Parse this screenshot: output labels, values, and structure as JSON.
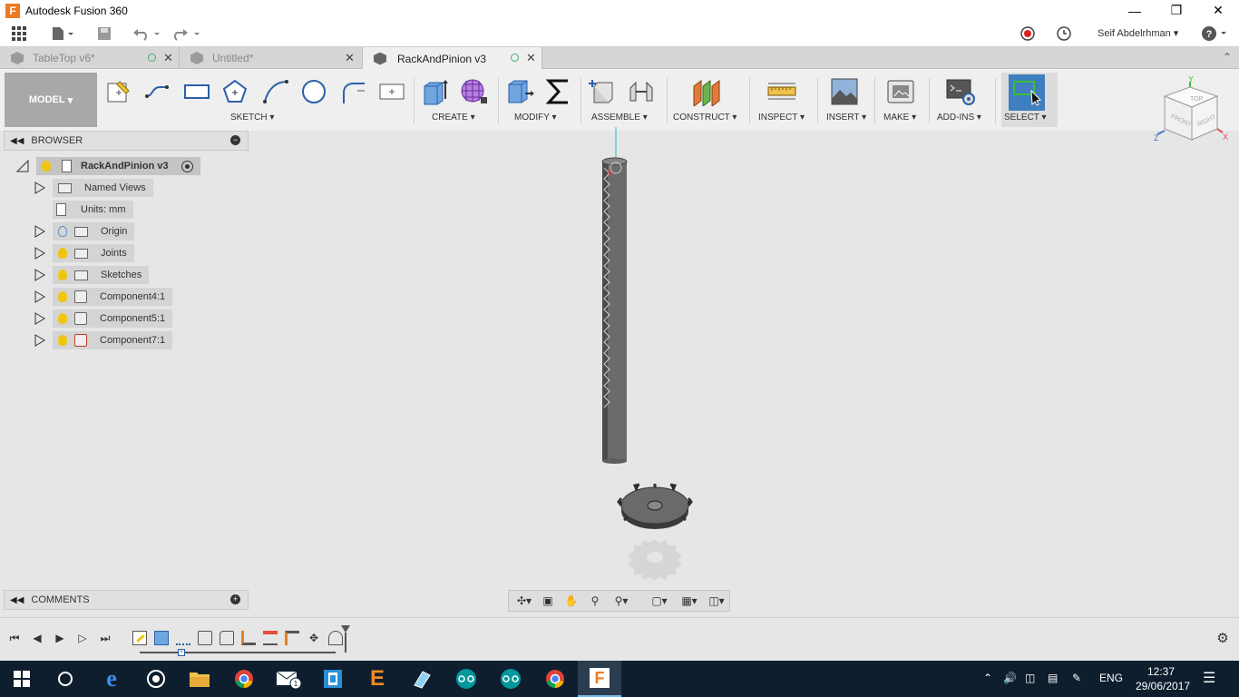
{
  "window": {
    "title": "Autodesk Fusion 360",
    "app_icon": "F"
  },
  "user": {
    "name": "Seif Abdelrhman",
    "help": "?"
  },
  "tabs": [
    {
      "label": "TableTop v6*"
    },
    {
      "label": "Untitled*"
    },
    {
      "label": "RackAndPinion v3"
    }
  ],
  "toolbar": {
    "mode": "MODEL",
    "groups": {
      "sketch": "SKETCH",
      "create": "CREATE",
      "modify": "MODIFY",
      "assemble": "ASSEMBLE",
      "construct": "CONSTRUCT",
      "inspect": "INSPECT",
      "insert": "INSERT",
      "make": "MAKE",
      "addins": "ADD-INS",
      "select": "SELECT"
    }
  },
  "viewcube": {
    "top": "TOP",
    "front": "FRONT",
    "right": "RIGHT",
    "axis_x": "X",
    "axis_y": "Y",
    "axis_z": "Z"
  },
  "browser": {
    "title": "BROWSER",
    "root": "RackAndPinion v3",
    "items": [
      {
        "label": "Named Views"
      },
      {
        "label": "Units: mm"
      },
      {
        "label": "Origin"
      },
      {
        "label": "Joints"
      },
      {
        "label": "Sketches"
      },
      {
        "label": "Component4:1"
      },
      {
        "label": "Component5:1"
      },
      {
        "label": "Component7:1"
      }
    ]
  },
  "comments": {
    "title": "COMMENTS"
  },
  "taskbar": {
    "language": "ENG",
    "time": "12:37",
    "date": "29/06/2017",
    "mail_badge": "1"
  },
  "colors": {
    "accent": "#ee7b22",
    "select_blue": "#3f7fbf",
    "taskbar": "#0f1e2e"
  }
}
